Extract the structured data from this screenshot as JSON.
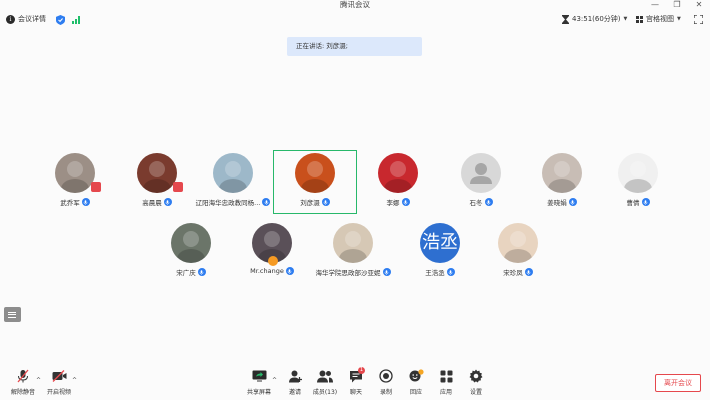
{
  "window": {
    "title": "腾讯会议"
  },
  "topbar": {
    "meeting_info_label": "会议详情",
    "timer_label": "43:51(60分钟)",
    "view_label": "宫格视图"
  },
  "speaker_banner": "正在讲话: 刘彦滠;",
  "participants_row1": [
    {
      "name": "武乔军",
      "avatar_color": "#9c8f86"
    },
    {
      "name": "高晨晨",
      "avatar_color": "#7a3b2e"
    },
    {
      "name": "辽阳海华忠政教同杨...",
      "avatar_color": "#9db8c9"
    },
    {
      "name": "刘彦滠",
      "avatar_color": "#c9501c",
      "speaking": true
    },
    {
      "name": "李娜",
      "avatar_color": "#c8282e"
    },
    {
      "name": "石冬",
      "avatar_color": "#d8d8d8"
    },
    {
      "name": "姜晓娟",
      "avatar_color": "#c8bdb5"
    },
    {
      "name": "曹倩",
      "avatar_color": "#f0f0f0"
    }
  ],
  "participants_row2": [
    {
      "name": "宋广庆",
      "avatar_color": "#6b7569"
    },
    {
      "name": "Mr.change",
      "avatar_color": "#5a5058"
    },
    {
      "name": "海华学院思政部沙亚妮",
      "avatar_color": "#d6c8b5"
    },
    {
      "name": "王浩丞",
      "avatar_color": "#2e6fd0",
      "avatar_text": "浩丞"
    },
    {
      "name": "宋珍凤",
      "avatar_color": "#e8d4c0"
    }
  ],
  "toolbar": {
    "unmute": "解除静音",
    "start_video": "开启视频",
    "share_screen": "共享屏幕",
    "invite": "邀请",
    "members": "成员(13)",
    "chat": "聊天",
    "chat_badge": "1",
    "record": "录制",
    "reactions": "回应",
    "apps": "应用",
    "settings": "设置",
    "leave": "离开会议"
  },
  "colors": {
    "accent": "#2e7df0",
    "speaking": "#27b86a",
    "danger": "#e5484d"
  }
}
